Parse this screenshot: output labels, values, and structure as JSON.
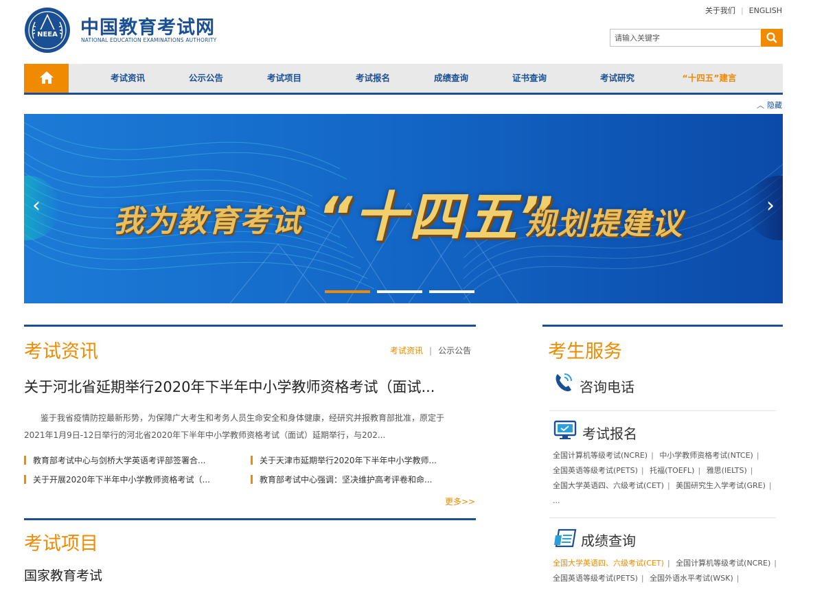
{
  "header": {
    "logo_cn": "中国教育考试网",
    "logo_en": "NATIONAL EDUCATION EXAMINATIONS AUTHORITY",
    "emblem_text": "NEEA",
    "about": "关于我们",
    "english": "ENGLISH",
    "search_placeholder": "请输入关键字"
  },
  "nav": {
    "items": [
      "考试资讯",
      "公示公告",
      "考试项目",
      "考试报名",
      "成绩查询",
      "证书查询",
      "考试研究",
      "“十四五”建言"
    ],
    "hide": "隐藏"
  },
  "banner": {
    "text_main": "我为教育考试",
    "text_big": "“十四五”",
    "text_tail": "规划提建议",
    "slides": 3,
    "active_slide": 1
  },
  "news": {
    "title": "考试资讯",
    "tabs": [
      "考试资讯",
      "公示公告"
    ],
    "headline": "关于河北省延期举行2020年下半年中小学教师资格考试（面试...",
    "summary": "鉴于我省疫情防控最新形势，为保障广大考生和考务人员生命安全和身体健康，经研究并报教育部批准，原定于2021年1月9日-12日举行的河北省2020年下半年中小学教师资格考试（面试）延期举行，与202...",
    "items": [
      "教育部考试中心与剑桥大学英语考评部签署合...",
      "关于天津市延期举行2020年下半年中小学教师...",
      "关于开展2020年下半年中小学教师资格考试（...",
      "教育部考试中心强调：坚决维护高考评卷和命..."
    ],
    "more": "更多>>"
  },
  "projects": {
    "title": "考试项目",
    "subtitle": "国家教育考试"
  },
  "service": {
    "title": "考生服务",
    "phone": "咨询电话",
    "registration": {
      "title": "考试报名",
      "links": [
        "全国计算机等级考试(NCRE)",
        "中小学教师资格考试(NTCE)",
        "全国英语等级考试(PETS)",
        "托福(TOEFL)",
        "雅思(IELTS)",
        "全国大学英语四、六级考试(CET)",
        "美国研究生入学考试(GRE)"
      ],
      "ellipsis": "..."
    },
    "scores": {
      "title": "成绩查询",
      "links": [
        "全国大学英语四、六级考试(CET)",
        "全国计算机等级考试(NCRE)",
        "全国英语等级考试(PETS)",
        "全国外语水平考试(WSK)"
      ]
    }
  },
  "colors": {
    "brand_blue": "#1a4f93",
    "accent_orange": "#f08a00"
  }
}
